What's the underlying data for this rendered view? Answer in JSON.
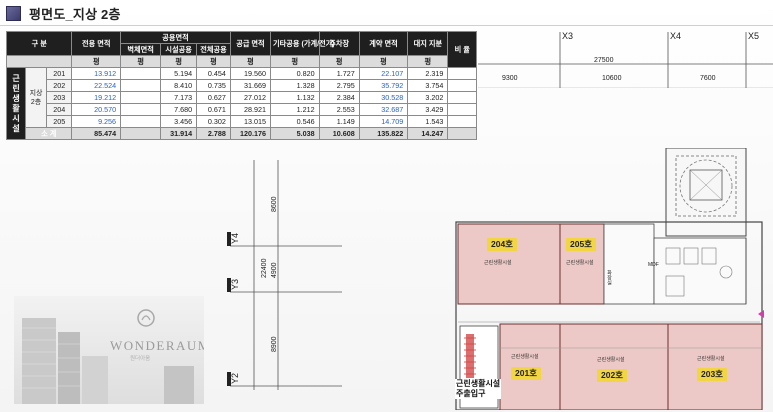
{
  "header": {
    "title": "평면도_지상 2층"
  },
  "table": {
    "side_label": "근린생활시설",
    "floor_label": "지상2층",
    "head_row1": [
      "구 분",
      "전용 면적",
      "공용면적",
      "공급 면적",
      "기타공용 (가계/전기)",
      "주차장",
      "계약 면적",
      "대지 지분",
      "비 율"
    ],
    "shared_sub": [
      "벽체면적",
      "시설공용",
      "전체공용"
    ],
    "unit_symbol": "평",
    "rows": [
      {
        "unit": "201",
        "exclusive": "13.912",
        "wall": "",
        "facility": "5.194",
        "shared_total": "0.454",
        "supply": "19.560",
        "etc": "0.820",
        "parking": "1.727",
        "contract": "22.107",
        "land": "2.319",
        "ratio": ""
      },
      {
        "unit": "202",
        "exclusive": "22.524",
        "wall": "",
        "facility": "8.410",
        "shared_total": "0.735",
        "supply": "31.669",
        "etc": "1.328",
        "parking": "2.795",
        "contract": "35.792",
        "land": "3.754",
        "ratio": ""
      },
      {
        "unit": "203",
        "exclusive": "19.212",
        "wall": "",
        "facility": "7.173",
        "shared_total": "0.627",
        "supply": "27.012",
        "etc": "1.132",
        "parking": "2.384",
        "contract": "30.528",
        "land": "3.202",
        "ratio": ""
      },
      {
        "unit": "204",
        "exclusive": "20.570",
        "wall": "",
        "facility": "7.680",
        "shared_total": "0.671",
        "supply": "28.921",
        "etc": "1.212",
        "parking": "2.553",
        "contract": "32.687",
        "land": "3.429",
        "ratio": ""
      },
      {
        "unit": "205",
        "exclusive": "9.256",
        "wall": "",
        "facility": "3.456",
        "shared_total": "0.302",
        "supply": "13.015",
        "etc": "0.546",
        "parking": "1.149",
        "contract": "14.709",
        "land": "1.543",
        "ratio": ""
      }
    ],
    "total": {
      "label": "소 계",
      "exclusive": "85.474",
      "wall": "",
      "facility": "31.914",
      "shared_total": "2.788",
      "supply": "120.176",
      "etc": "5.038",
      "parking": "10.608",
      "contract": "135.822",
      "land": "14.247",
      "ratio": ""
    }
  },
  "grid": {
    "top_labels": [
      "X3",
      "X4",
      "X5"
    ],
    "total_width": "27500",
    "spans": [
      "9300",
      "10600",
      "7600"
    ],
    "left_labels": [
      "Y4",
      "Y3",
      "Y2"
    ],
    "total_height": "22400",
    "v_spans": [
      "8600",
      "4900",
      "8900"
    ]
  },
  "logo": {
    "brand": "WONDERAUM",
    "sub": "원더아움"
  },
  "plan": {
    "units": [
      {
        "no": "204호",
        "use": "근린생활시설"
      },
      {
        "no": "205호",
        "use": "근린생활시설"
      },
      {
        "no": "201호",
        "use": "근린생활시설"
      },
      {
        "no": "202호",
        "use": "근린생활시설"
      },
      {
        "no": "203호",
        "use": "근린생활시설"
      }
    ],
    "restroom": "화장실",
    "mdf": "MDF",
    "entrance_line1": "근린생활시설",
    "entrance_line2": "주출입구"
  },
  "colors": {
    "unit_fill": "#ecc9c6",
    "badge": "#f2d542",
    "header_dark": "#1f1f1f",
    "blue_value": "#2a63c4"
  }
}
